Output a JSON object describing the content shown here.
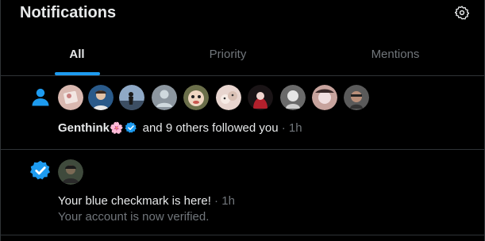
{
  "header": {
    "title": "Notifications",
    "settings_icon": "gear-icon"
  },
  "tabs": [
    {
      "label": "All",
      "active": true
    },
    {
      "label": "Priority",
      "active": false
    },
    {
      "label": "Mentions",
      "active": false
    }
  ],
  "colors": {
    "accent": "#1d9bf0",
    "background": "#000000",
    "text": "#e7e9ea",
    "muted": "#71767b",
    "divider": "#2f3336"
  },
  "notifications": [
    {
      "type_icon": "person-icon",
      "avatar_count": 10,
      "name": "Genthink",
      "name_emoji": "🌸",
      "verified": true,
      "text": " and 9 others followed you",
      "sep": " · ",
      "time": "1h"
    },
    {
      "type_icon": "verified-badge-icon",
      "title": "Your blue checkmark is here!",
      "sep": " · ",
      "time": "1h",
      "subtitle": "Your account is now verified."
    }
  ]
}
